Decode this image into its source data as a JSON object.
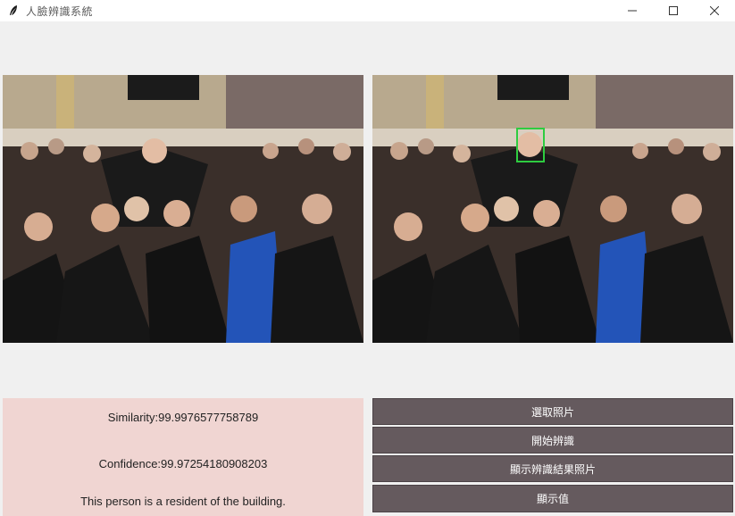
{
  "window": {
    "title": "人臉辨識系統",
    "icon": "feather-icon",
    "controls": [
      "minimize-icon",
      "maximize-icon",
      "close-icon"
    ]
  },
  "images": {
    "left": {
      "icon": "photo-icon"
    },
    "right": {
      "icon": "photo-icon",
      "highlight_color": "#2ecc40"
    }
  },
  "result": {
    "similarity": "Similarity:99.9976577758789",
    "confidence": "Confidence:99.97254180908203",
    "status": "This person is a resident of the building."
  },
  "buttons": {
    "select_photo": "選取照片",
    "start_recognition": "開始辨識",
    "show_result_photo": "顯示辨識結果照片",
    "show_value": "顯示值"
  },
  "colors": {
    "button_bg": "#655a5e",
    "result_bg": "#f0d5d2",
    "face_box": "#2ecc40"
  }
}
